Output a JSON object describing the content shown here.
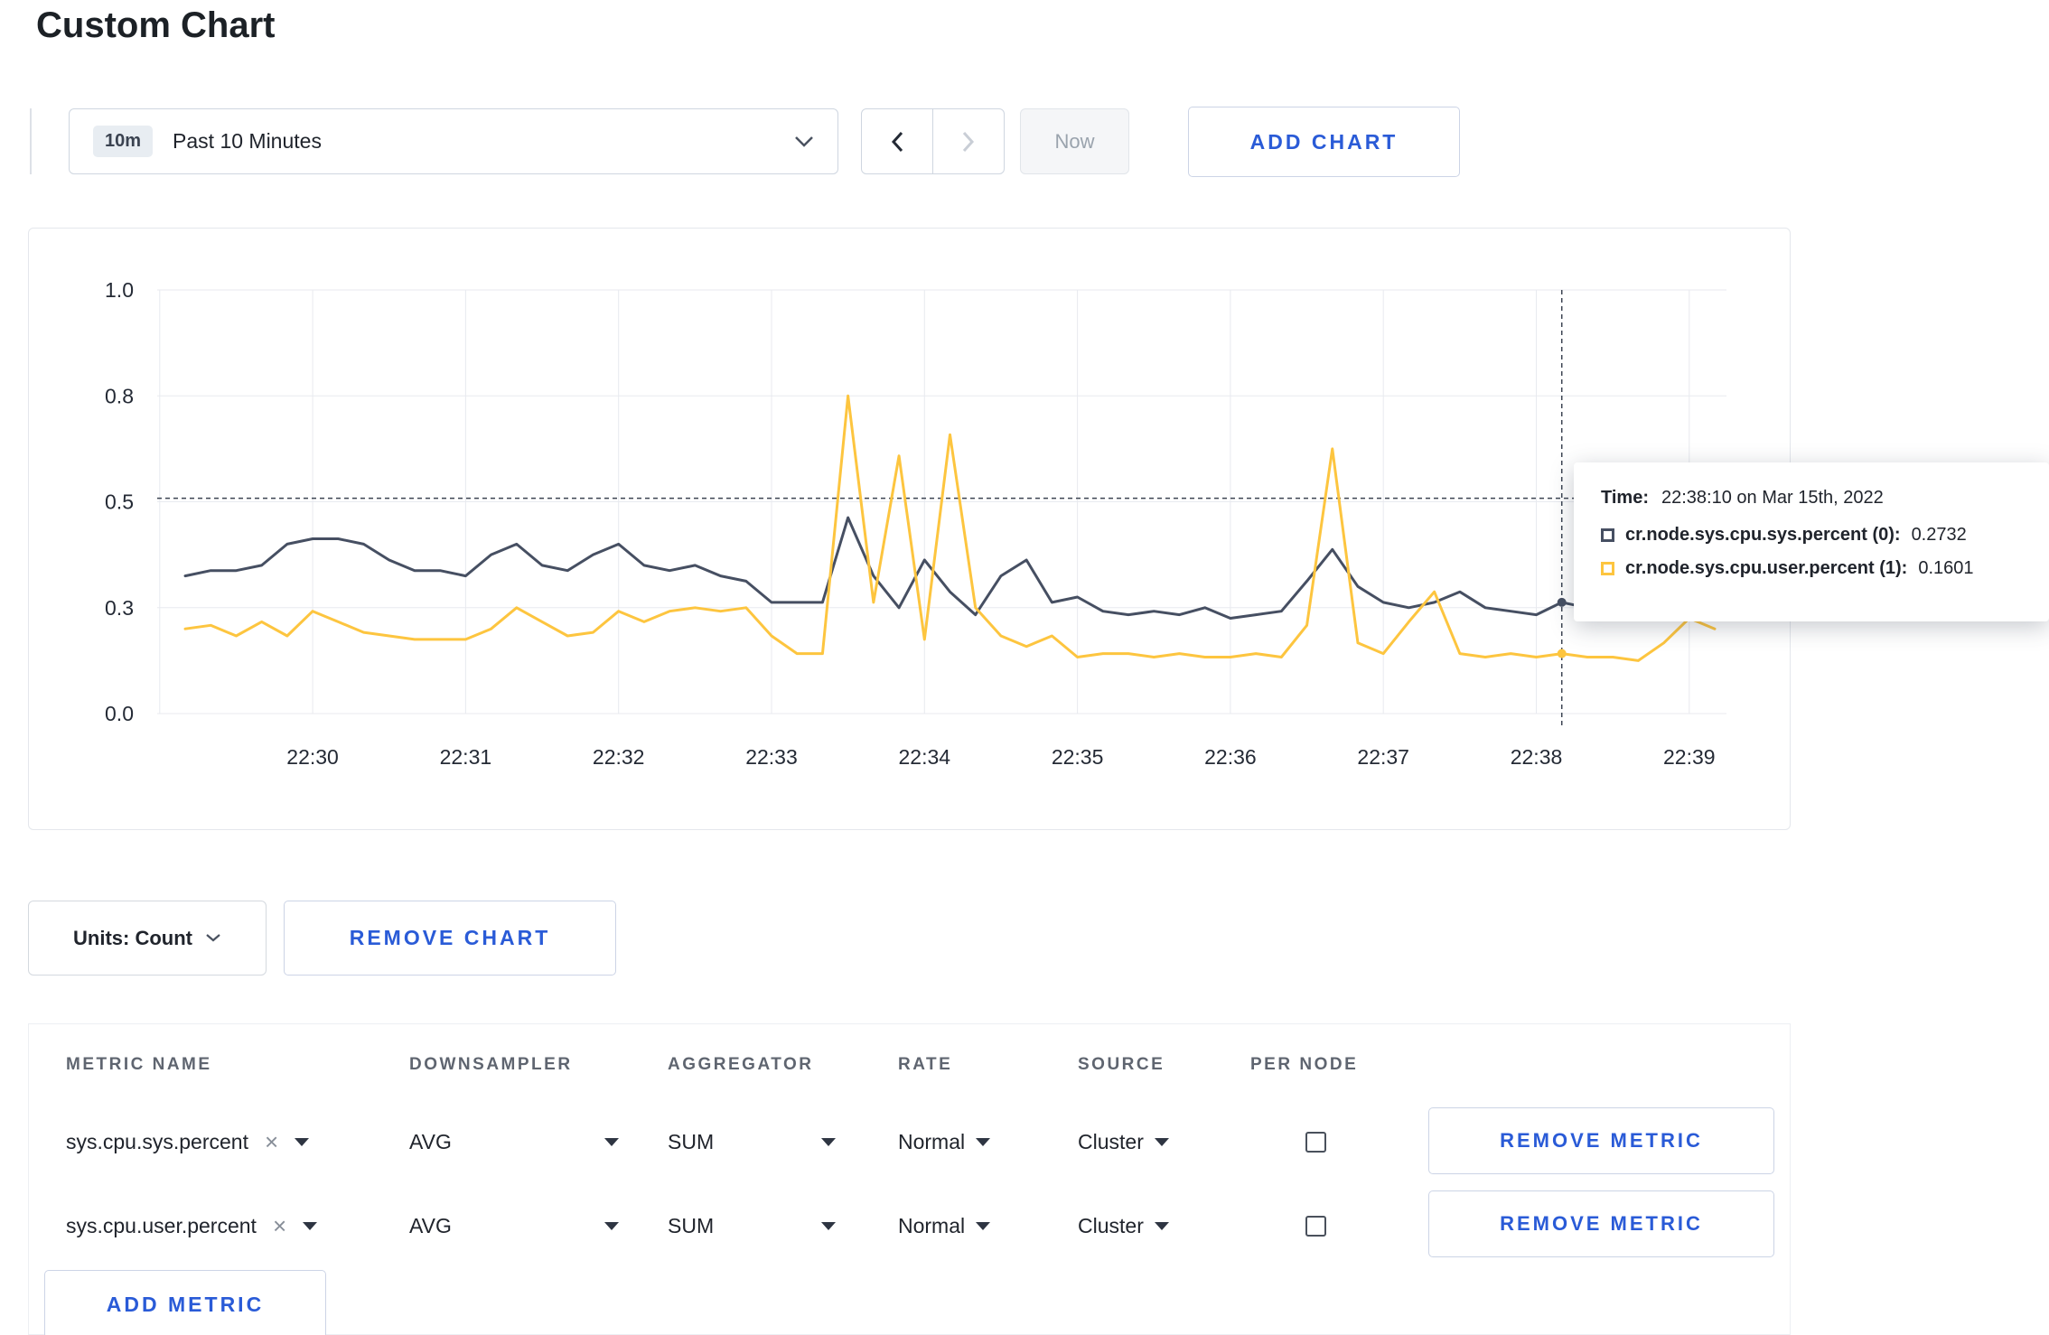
{
  "page": {
    "title": "Custom Chart"
  },
  "toolbar": {
    "time_badge": "10m",
    "time_label": "Past 10 Minutes",
    "now_label": "Now",
    "add_chart_label": "ADD CHART"
  },
  "chart_data": {
    "type": "line",
    "x_tick_labels": [
      "22:30",
      "22:31",
      "22:32",
      "22:33",
      "22:34",
      "22:35",
      "22:36",
      "22:37",
      "22:38",
      "22:39"
    ],
    "y_tick_labels": [
      "0.0",
      "0.3",
      "0.5",
      "0.8",
      "1.0"
    ],
    "y_tick_values": [
      0,
      0.3,
      0.5,
      0.8,
      1.0
    ],
    "sample_interval_sec": 10,
    "series": [
      {
        "name": "cr.node.sys.cpu.sys.percent",
        "color": "#464f62",
        "values": [
          0.36,
          0.37,
          0.37,
          0.38,
          0.42,
          0.43,
          0.43,
          0.42,
          0.39,
          0.37,
          0.37,
          0.36,
          0.4,
          0.42,
          0.38,
          0.37,
          0.4,
          0.42,
          0.38,
          0.37,
          0.38,
          0.36,
          0.35,
          0.31,
          0.31,
          0.31,
          0.47,
          0.36,
          0.3,
          0.39,
          0.33,
          0.28,
          0.36,
          0.39,
          0.31,
          0.32,
          0.29,
          0.28,
          0.29,
          0.28,
          0.3,
          0.27,
          0.28,
          0.29,
          0.35,
          0.41,
          0.34,
          0.31,
          0.3,
          0.31,
          0.33,
          0.3,
          0.29,
          0.28,
          0.31,
          0.3,
          0.29,
          0.3,
          0.31,
          0.3,
          0.3
        ]
      },
      {
        "name": "cr.node.sys.cpu.user.percent",
        "color": "#fdc53f",
        "values": [
          0.24,
          0.25,
          0.22,
          0.26,
          0.22,
          0.29,
          0.26,
          0.23,
          0.22,
          0.21,
          0.21,
          0.21,
          0.24,
          0.3,
          0.26,
          0.22,
          0.23,
          0.29,
          0.26,
          0.29,
          0.3,
          0.29,
          0.3,
          0.22,
          0.17,
          0.17,
          0.8,
          0.31,
          0.63,
          0.21,
          0.69,
          0.3,
          0.22,
          0.19,
          0.22,
          0.16,
          0.17,
          0.17,
          0.16,
          0.17,
          0.16,
          0.16,
          0.17,
          0.16,
          0.25,
          0.65,
          0.2,
          0.17,
          0.26,
          0.33,
          0.17,
          0.16,
          0.17,
          0.16,
          0.17,
          0.16,
          0.16,
          0.15,
          0.2,
          0.27,
          0.24
        ]
      }
    ],
    "crosshair": {
      "time_sec": 540,
      "hline_value": 0.51
    }
  },
  "tooltip": {
    "time_label": "Time:",
    "time_value": "22:38:10 on Mar 15th, 2022",
    "rows": [
      {
        "name": "cr.node.sys.cpu.sys.percent (0):",
        "value": "0.2732",
        "color": "#464f62"
      },
      {
        "name": "cr.node.sys.cpu.user.percent (1):",
        "value": "0.1601",
        "color": "#fdc53f"
      }
    ]
  },
  "chart_controls": {
    "units_label": "Units: Count",
    "remove_chart_label": "REMOVE CHART"
  },
  "metrics_table": {
    "headers": [
      "METRIC NAME",
      "DOWNSAMPLER",
      "AGGREGATOR",
      "RATE",
      "SOURCE",
      "PER NODE"
    ],
    "rows": [
      {
        "metric": "sys.cpu.sys.percent",
        "downsampler": "AVG",
        "aggregator": "SUM",
        "rate": "Normal",
        "source": "Cluster",
        "remove_label": "REMOVE METRIC"
      },
      {
        "metric": "sys.cpu.user.percent",
        "downsampler": "AVG",
        "aggregator": "SUM",
        "rate": "Normal",
        "source": "Cluster",
        "remove_label": "REMOVE METRIC"
      }
    ],
    "add_metric_label": "ADD METRIC"
  },
  "colors": {
    "accent_blue": "#2a5bd7",
    "grid": "#e8eaef"
  }
}
